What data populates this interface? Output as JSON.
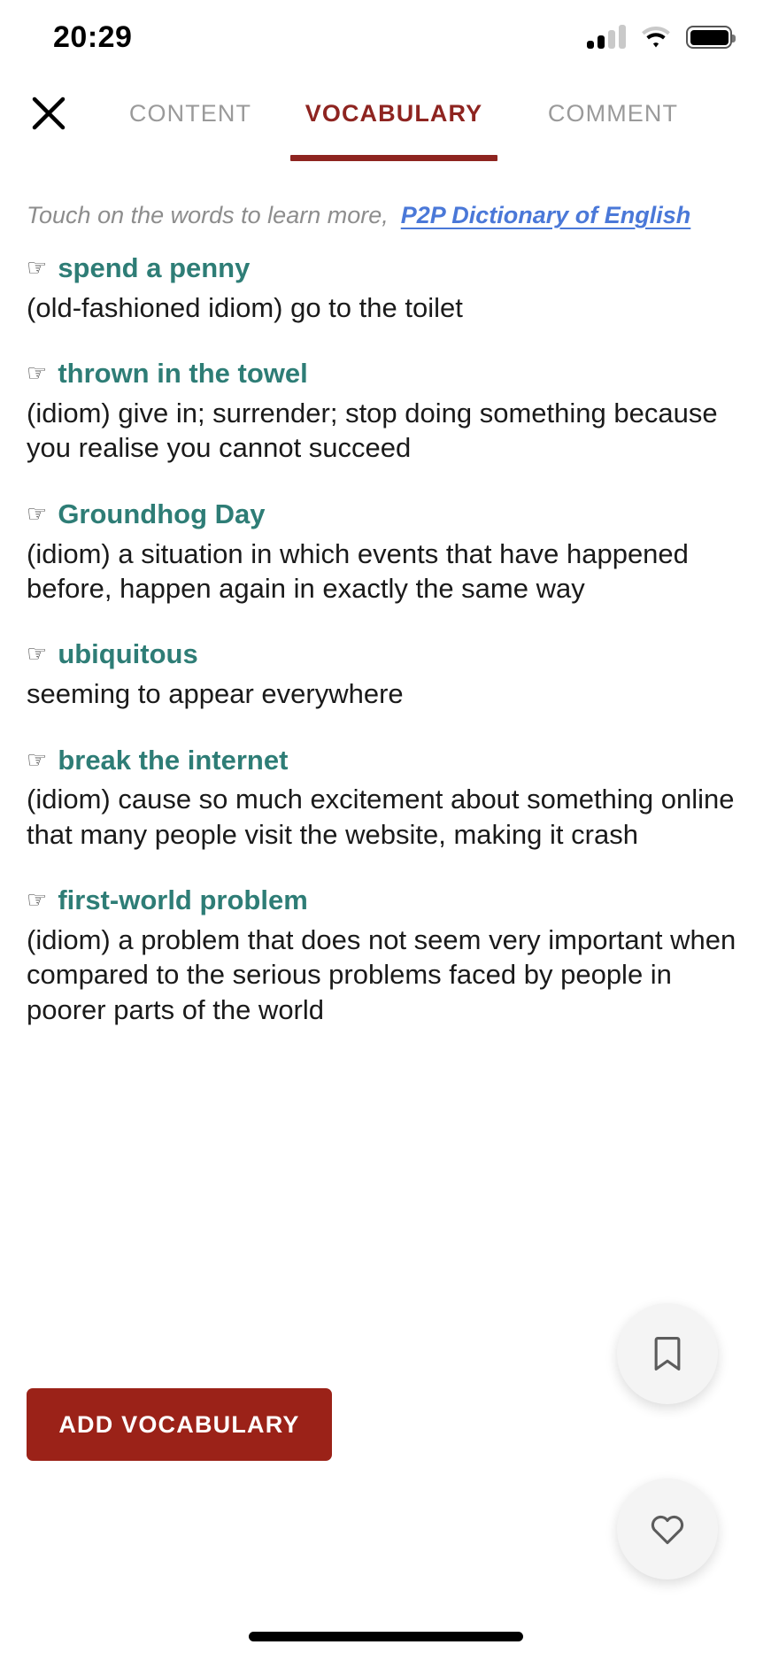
{
  "status_bar": {
    "time": "20:29",
    "signal_icon": "cellular-signal-icon",
    "wifi_icon": "wifi-icon",
    "battery_icon": "battery-full-icon"
  },
  "header": {
    "close_icon": "close-icon",
    "tabs": [
      {
        "label": "CONTENT",
        "active": false
      },
      {
        "label": "VOCABULARY",
        "active": true
      },
      {
        "label": "COMMENT",
        "active": false
      }
    ],
    "active_tab_color": "#8e2420",
    "inactive_tab_color": "#9a9a9a"
  },
  "hint": {
    "text": "Touch on the words to learn more,",
    "link_label": "P2P Dictionary of English",
    "link_color": "#4a78d8"
  },
  "vocabulary": {
    "bullet_icon": "pointing-hand-icon",
    "term_color": "#2e7d76",
    "entries": [
      {
        "term": "spend a penny",
        "definition": "(old-fashioned idiom) go to the toilet"
      },
      {
        "term": "thrown in the towel",
        "definition": "(idiom) give in; surrender; stop doing something because you realise you cannot succeed"
      },
      {
        "term": "Groundhog Day",
        "definition": "(idiom) a situation in which events that have happened before, happen again in exactly the same way"
      },
      {
        "term": "ubiquitous",
        "definition": "seeming to appear everywhere"
      },
      {
        "term": "break the internet",
        "definition": "(idiom) cause so much excitement about something online that many people visit the website, making it crash"
      },
      {
        "term": "first-world problem",
        "definition": "(idiom) a problem that does not seem very important when compared to the serious problems faced by people in poorer parts of the world"
      }
    ]
  },
  "actions": {
    "add_vocabulary_label": "ADD VOCABULARY",
    "add_vocabulary_color": "#9b2218",
    "bookmark_icon": "bookmark-icon",
    "like_icon": "heart-icon"
  }
}
